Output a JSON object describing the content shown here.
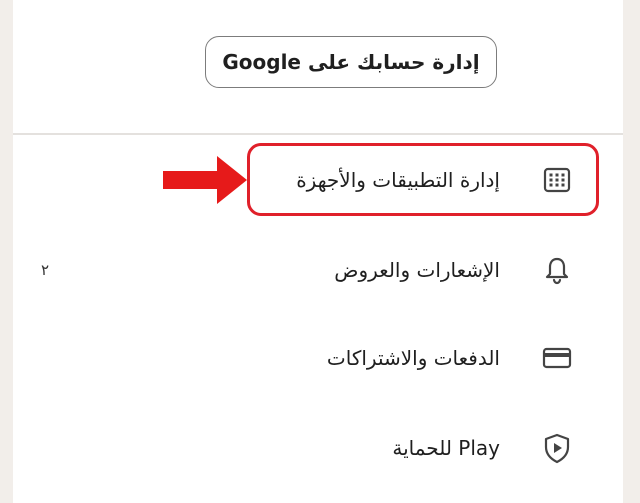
{
  "account": {
    "manage_button_label": "إدارة حسابك على Google"
  },
  "menu": {
    "items": [
      {
        "label": "إدارة التطبيقات والأجهزة",
        "icon": "apps-grid-icon"
      },
      {
        "label": "الإشعارات والعروض",
        "icon": "bell-icon",
        "badge": "٢"
      },
      {
        "label": "الدفعات والاشتراكات",
        "icon": "credit-card-icon"
      },
      {
        "label": "Play للحماية",
        "icon": "play-protect-shield-icon"
      }
    ]
  },
  "annotation": {
    "highlight_color": "#e0202a",
    "arrow_color": "#e61a1a"
  }
}
